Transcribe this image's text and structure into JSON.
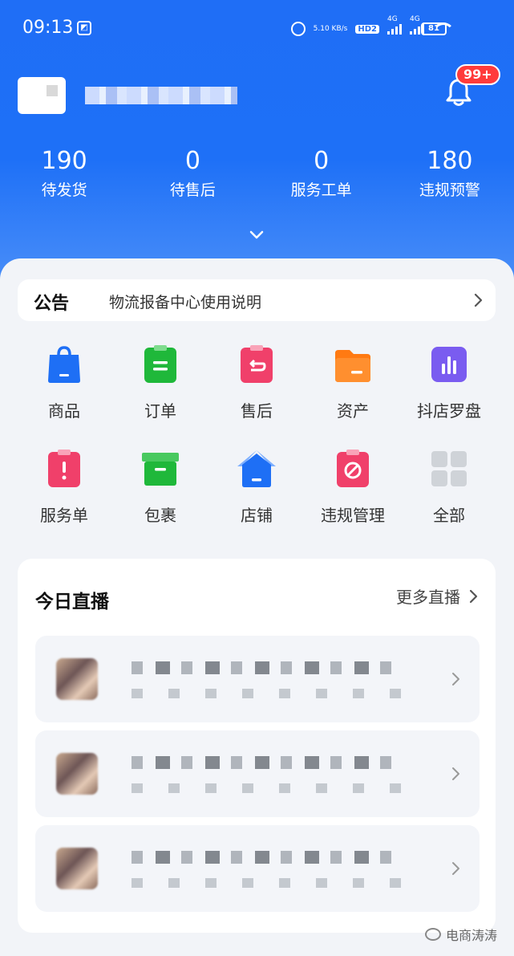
{
  "status_bar": {
    "time": "09:13",
    "net_speed": "5.10 KB/s",
    "hd": "HD2",
    "sim1": "4G",
    "sim2": "4G",
    "battery": "81"
  },
  "header": {
    "notification_badge": "99+"
  },
  "stats": [
    {
      "value": "190",
      "label": "待发货"
    },
    {
      "value": "0",
      "label": "待售后"
    },
    {
      "value": "0",
      "label": "服务工单"
    },
    {
      "value": "180",
      "label": "违规预警"
    }
  ],
  "notice": {
    "tag": "公告",
    "text": "物流报备中心使用说明"
  },
  "shortcuts": [
    {
      "label": "商品",
      "icon": "shopping-bag-icon",
      "color": "#1e6ff5"
    },
    {
      "label": "订单",
      "icon": "order-clipboard-icon",
      "color": "#1fb83a"
    },
    {
      "label": "售后",
      "icon": "return-clipboard-icon",
      "color": "#f0406a"
    },
    {
      "label": "资产",
      "icon": "wallet-folder-icon",
      "color": "#ff7a12"
    },
    {
      "label": "抖店罗盘",
      "icon": "bar-chart-icon",
      "color": "#7a5cf0"
    },
    {
      "label": "服务单",
      "icon": "alert-clipboard-icon",
      "color": "#f0406a"
    },
    {
      "label": "包裹",
      "icon": "package-box-icon",
      "color": "#1fb83a"
    },
    {
      "label": "店铺",
      "icon": "home-icon",
      "color": "#1e6ff5"
    },
    {
      "label": "违规管理",
      "icon": "forbidden-icon",
      "color": "#f0406a"
    },
    {
      "label": "全部",
      "icon": "grid-icon",
      "color": "#cfd3d8"
    }
  ],
  "live": {
    "title": "今日直播",
    "more": "更多直播"
  },
  "watermark": "电商涛涛"
}
